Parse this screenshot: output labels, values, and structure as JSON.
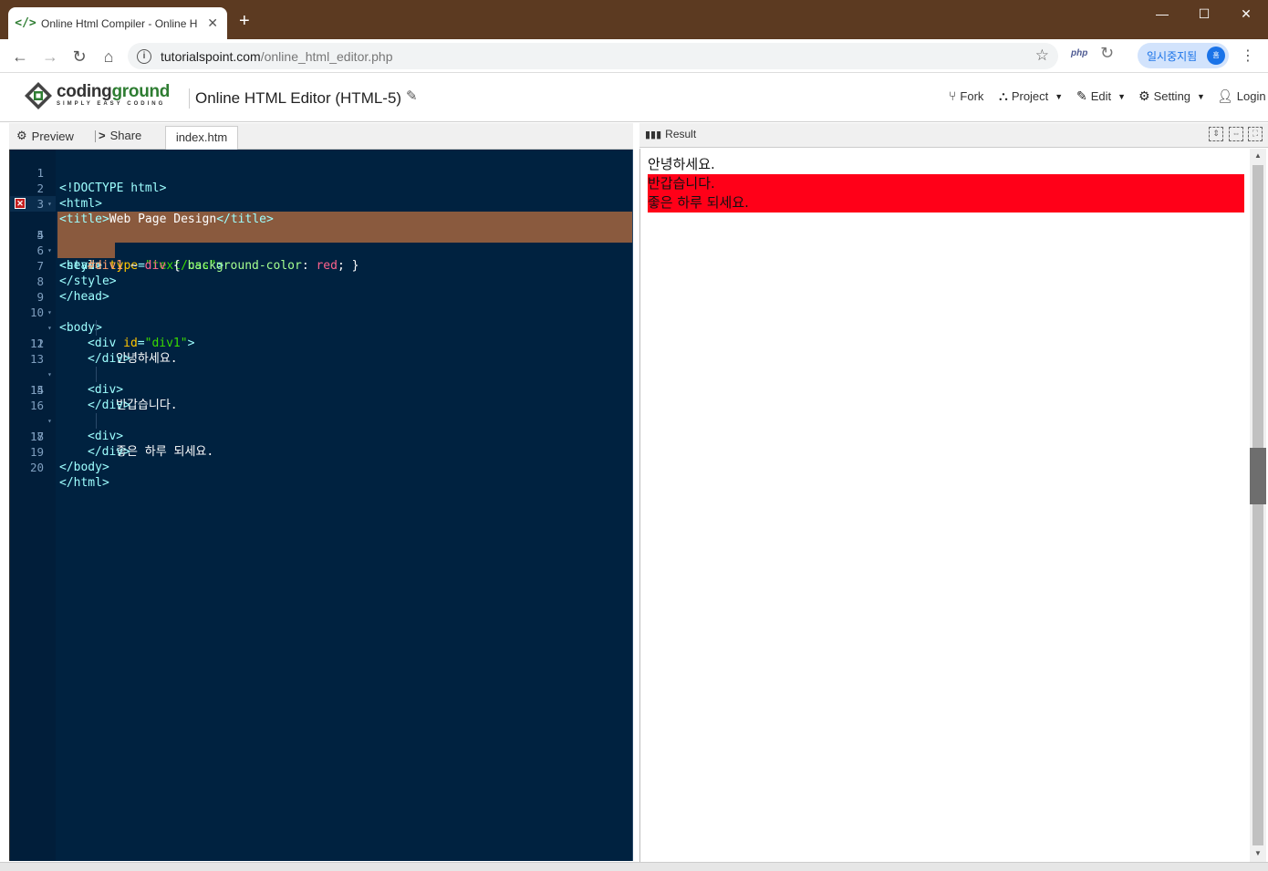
{
  "browser": {
    "tab_title": "Online Html Compiler - Online H",
    "favicon_text": "</>",
    "url_host": "tutorialspoint.com",
    "url_path": "/online_html_editor.php",
    "paused_label": "일시중지됨",
    "avatar_initial": "홈",
    "php_label": "php"
  },
  "app": {
    "logo_brand_1": "coding",
    "logo_brand_2": "ground",
    "logo_tagline": "SIMPLY EASY CODING",
    "page_title": "Online HTML Editor (HTML-5)",
    "menu": {
      "fork": "Fork",
      "project": "Project",
      "edit": "Edit",
      "setting": "Setting",
      "login": "Login"
    }
  },
  "left_panel": {
    "preview_label": "Preview",
    "share_label": "Share",
    "file_tab": "index.htm"
  },
  "right_panel": {
    "result_label": "Result"
  },
  "editor": {
    "line_numbers": [
      "1",
      "2",
      "3",
      "4",
      "5",
      "6",
      "7",
      "8",
      "9",
      "10",
      "11",
      "12",
      "13",
      "14",
      "15",
      "16",
      "17",
      "18",
      "19",
      "20"
    ],
    "l1": "<!DOCTYPE html>",
    "l2": "<html>",
    "l3_open": "<title>",
    "l3_text": "Web Page Design",
    "l3_close": "</title>",
    "l4": "<head>",
    "l5_tag": "<style ",
    "l5_attr": "type",
    "l5_eq": "=",
    "l5_val": "\"text/css\"",
    "l5_end": ">",
    "l6_sel": "#div1",
    "l6_op": " ~ ",
    "l6_el": "div",
    "l6_brace_open": " { ",
    "l6_prop": "background-color",
    "l6_colon": ": ",
    "l6_val": "red",
    "l6_end": "; }",
    "l7": "</style>",
    "l8": "</head>",
    "l9": "<body>",
    "l10_tag": "<div ",
    "l10_attr": "id",
    "l10_eq": "=",
    "l10_val": "\"div1\"",
    "l10_end": ">",
    "l11": "안녕하세요.",
    "l12": "</div>",
    "l13": "<div>",
    "l14": "반갑습니다.",
    "l15": "</div>",
    "l16": "<div>",
    "l17": "좋은 하루 되세요.",
    "l18": "</div>",
    "l19": "</body>",
    "l20": "</html>"
  },
  "result": {
    "line1": "안녕하세요.",
    "line2": "반갑습니다.",
    "line3": "좋은 하루 되세요.",
    "highlight_color": "#ff0018"
  },
  "colors": {
    "titlebar": "#5c3a21",
    "editor_bg": "#002240",
    "selection_bg": "#8a5a3e",
    "brand_green": "#2e7d32"
  }
}
